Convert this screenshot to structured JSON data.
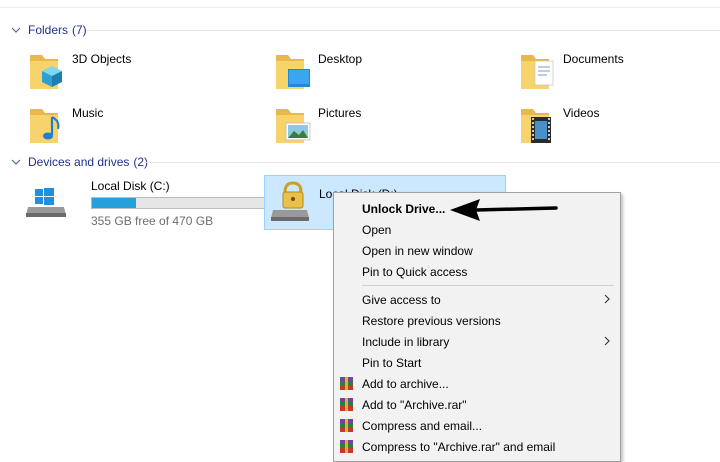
{
  "folders_group": {
    "label": "Folders",
    "count": "(7)"
  },
  "folders": [
    {
      "name": "3D Objects",
      "icon": "3d-objects-folder-icon"
    },
    {
      "name": "Desktop",
      "icon": "desktop-folder-icon"
    },
    {
      "name": "Documents",
      "icon": "documents-folder-icon"
    },
    {
      "name": "Music",
      "icon": "music-folder-icon"
    },
    {
      "name": "Pictures",
      "icon": "pictures-folder-icon"
    },
    {
      "name": "Videos",
      "icon": "videos-folder-icon"
    }
  ],
  "drives_group": {
    "label": "Devices and drives",
    "count": "(2)"
  },
  "drives": [
    {
      "name": "Local Disk (C:)",
      "free": "355 GB free of 470 GB",
      "used_fraction": 0.245,
      "icon": "windows-drive-icon"
    },
    {
      "name": "Local Disk (D:)",
      "icon": "locked-drive-icon"
    }
  ],
  "context_menu": {
    "items": [
      {
        "label": "Unlock Drive...",
        "bold": true
      },
      {
        "label": "Open"
      },
      {
        "label": "Open in new window"
      },
      {
        "label": "Pin to Quick access"
      },
      {
        "label": "Give access to",
        "submenu": true
      },
      {
        "label": "Restore previous versions"
      },
      {
        "label": "Include in library",
        "submenu": true
      },
      {
        "label": "Pin to Start"
      },
      {
        "label": "Add to archive...",
        "icon": "winrar-icon"
      },
      {
        "label": "Add to \"Archive.rar\"",
        "icon": "winrar-icon"
      },
      {
        "label": "Compress and email...",
        "icon": "winrar-icon"
      },
      {
        "label": "Compress to \"Archive.rar\" and email",
        "icon": "winrar-icon"
      }
    ]
  },
  "colors": {
    "header_text": "#1e3287",
    "selection": "#cce8ff",
    "bar_fill": "#26a0da",
    "menu_bg": "#f2f2f2"
  }
}
